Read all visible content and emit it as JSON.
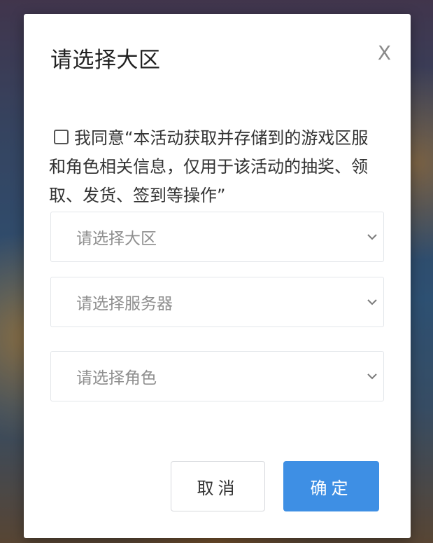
{
  "dialog": {
    "title": "请选择大区",
    "close_label": "X"
  },
  "agreement": {
    "checked": false,
    "text": "我同意“本活动获取并存储到的游戏区服和角色相关信息，仅用于该活动的抽奖、领取、发货、签到等操作”"
  },
  "selects": {
    "region_placeholder": "请选择大区",
    "server_placeholder": "请选择服务器",
    "role_placeholder": "请选择角色"
  },
  "buttons": {
    "cancel_label": "取消",
    "confirm_label": "确定"
  },
  "colors": {
    "primary": "#3e8fe4",
    "placeholder_text": "#8f8f8f",
    "border": "#e3e6ea"
  }
}
